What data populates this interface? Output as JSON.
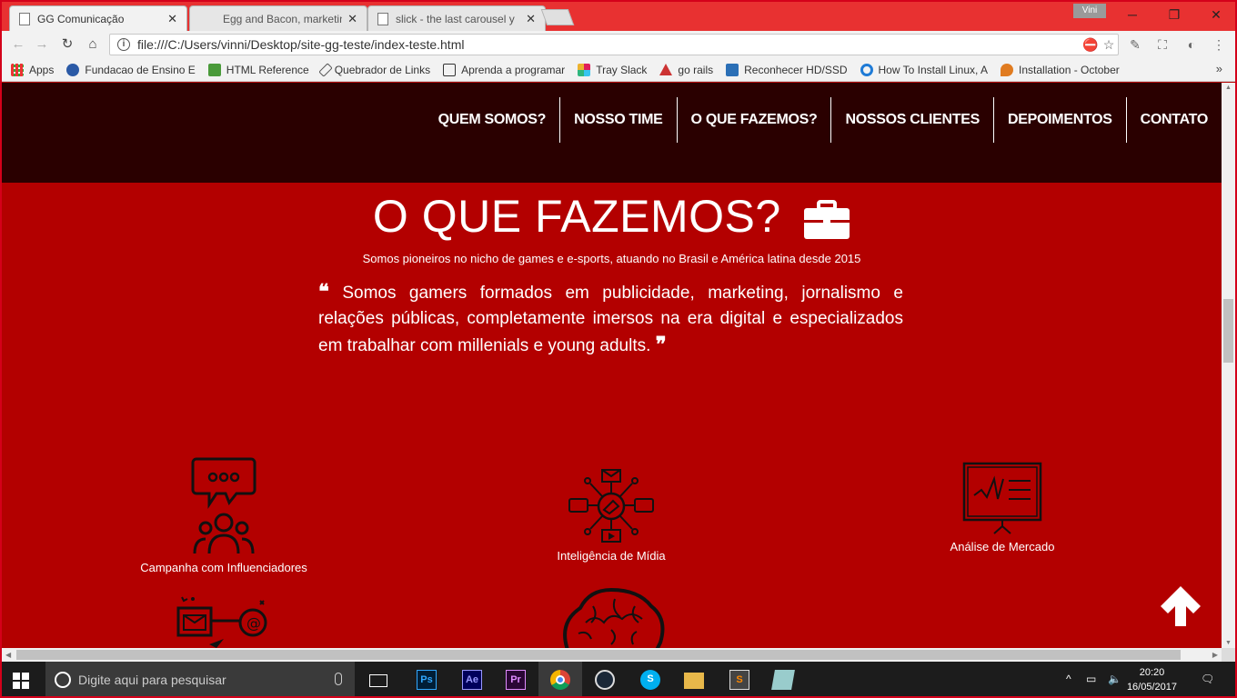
{
  "browser": {
    "tabs": [
      {
        "title": "GG Comunicação",
        "active": true
      },
      {
        "title": "Egg and Bacon, marketin",
        "active": false
      },
      {
        "title": "slick - the last carousel y",
        "active": false
      }
    ],
    "profile_name": "Vini",
    "url": "file:///C:/Users/vinni/Desktop/site-gg-teste/index-teste.html",
    "bookmarks": [
      {
        "label": "Apps",
        "icon": "apps-grid-icon",
        "color": "#d44"
      },
      {
        "label": "Fundacao de Ensino E",
        "icon": "otm-icon",
        "color": "#2b5aa6"
      },
      {
        "label": "HTML Reference",
        "icon": "w3-icon",
        "color": "#4a9a3a"
      },
      {
        "label": "Quebrador de Links",
        "icon": "link-tool-icon",
        "color": "#555"
      },
      {
        "label": "Aprenda a programar",
        "icon": "code-icon",
        "color": "#333"
      },
      {
        "label": "Tray Slack",
        "icon": "slack-icon",
        "color": "#6b3d7a"
      },
      {
        "label": "go rails",
        "icon": "gorails-icon",
        "color": "#c33"
      },
      {
        "label": "Reconhecer HD/SSD",
        "icon": "hd-icon",
        "color": "#2b6fb6"
      },
      {
        "label": "How To Install Linux, A",
        "icon": "digitalocean-icon",
        "color": "#1f7bd6"
      },
      {
        "label": "Installation - October",
        "icon": "october-icon",
        "color": "#e07b20"
      }
    ]
  },
  "site": {
    "menu": [
      "QUEM SOMOS?",
      "NOSSO TIME",
      "O QUE FAZEMOS?",
      "NOSSOS CLIENTES",
      "DEPOIMENTOS",
      "CONTATO"
    ],
    "section_title": "O QUE FAZEMOS?",
    "subtitle": "Somos pioneiros no nicho de games e e-sports, atuando no Brasil e América latina desde 2015",
    "quote": "Somos gamers formados em publicidade, marketing, jornalismo e relações públicas, completamente imersos na era digital e especializados em trabalhar com millenials e young adults.",
    "services": [
      {
        "label": "Campanha com Influenciadores",
        "icon": "influencer-chat-icon"
      },
      {
        "label": "Inteligência de Mídia",
        "icon": "media-network-icon"
      },
      {
        "label": "Análise de Mercado",
        "icon": "market-chart-board-icon"
      }
    ],
    "colors": {
      "nav_bg": "#2a0000",
      "section_bg": "#b30000",
      "text": "#ffffff"
    }
  },
  "taskbar": {
    "search_placeholder": "Digite aqui para pesquisar",
    "apps": [
      {
        "label": "Ps",
        "color": "#31a8ff"
      },
      {
        "label": "Ae",
        "color": "#9999ff"
      },
      {
        "label": "Pr",
        "color": "#e08cff"
      }
    ],
    "time": "20:20",
    "date": "16/05/2017"
  }
}
